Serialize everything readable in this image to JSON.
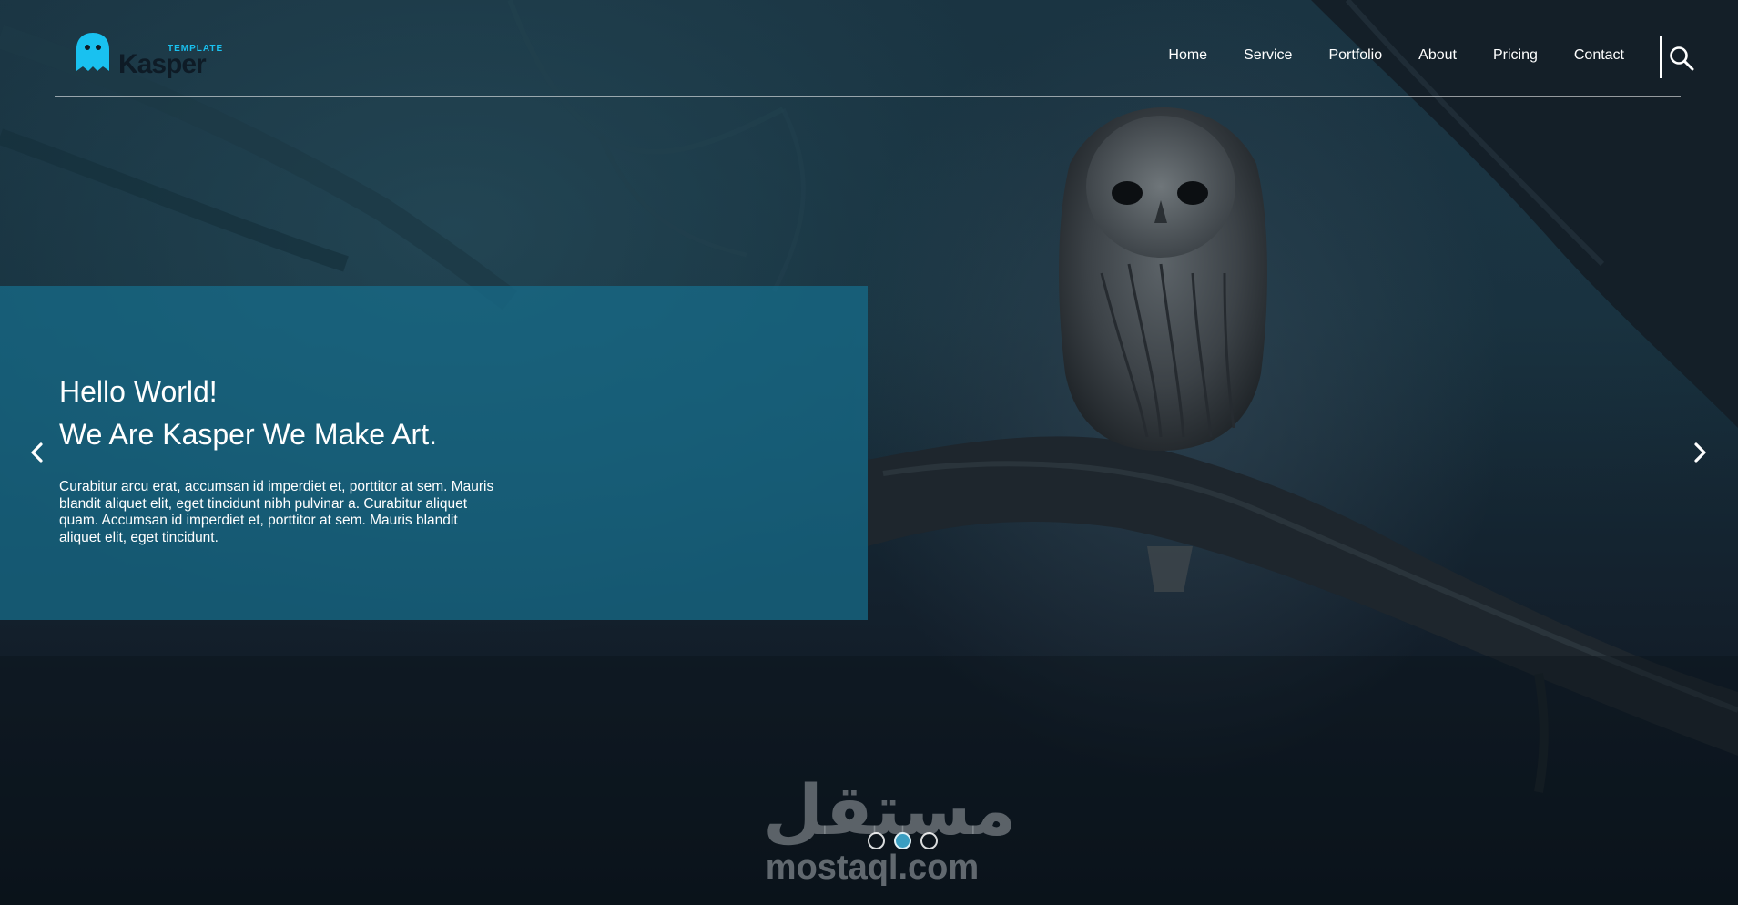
{
  "header": {
    "logo": {
      "tag": "TEMPLATE",
      "word": "Kasper"
    },
    "nav": [
      {
        "label": "Home"
      },
      {
        "label": "Service"
      },
      {
        "label": "Portfolio"
      },
      {
        "label": "About"
      },
      {
        "label": "Pricing"
      },
      {
        "label": "Contact"
      }
    ],
    "search_icon": "search-icon"
  },
  "hero": {
    "title_line1": "Hello World!",
    "title_line2": "We Are Kasper We Make Art.",
    "body": "Curabitur arcu erat, accumsan id imperdiet et, porttitor at sem. Mauris blandit aliquet elit, eget tincidunt nibh pulvinar a. Curabitur aliquet quam. Accumsan id imperdiet et, porttitor at sem. Mauris blandit aliquet elit, eget tincidunt."
  },
  "slider": {
    "prev_icon": "chevron-left-icon",
    "next_icon": "chevron-right-icon",
    "dots": 3,
    "active_dot": 2
  },
  "watermark": {
    "arabic": "مستقل",
    "domain": "mostaql.com"
  },
  "colors": {
    "accent": "#19c1f0",
    "hero_box": "#166e8c",
    "active_dot": "#3a9ec1"
  }
}
